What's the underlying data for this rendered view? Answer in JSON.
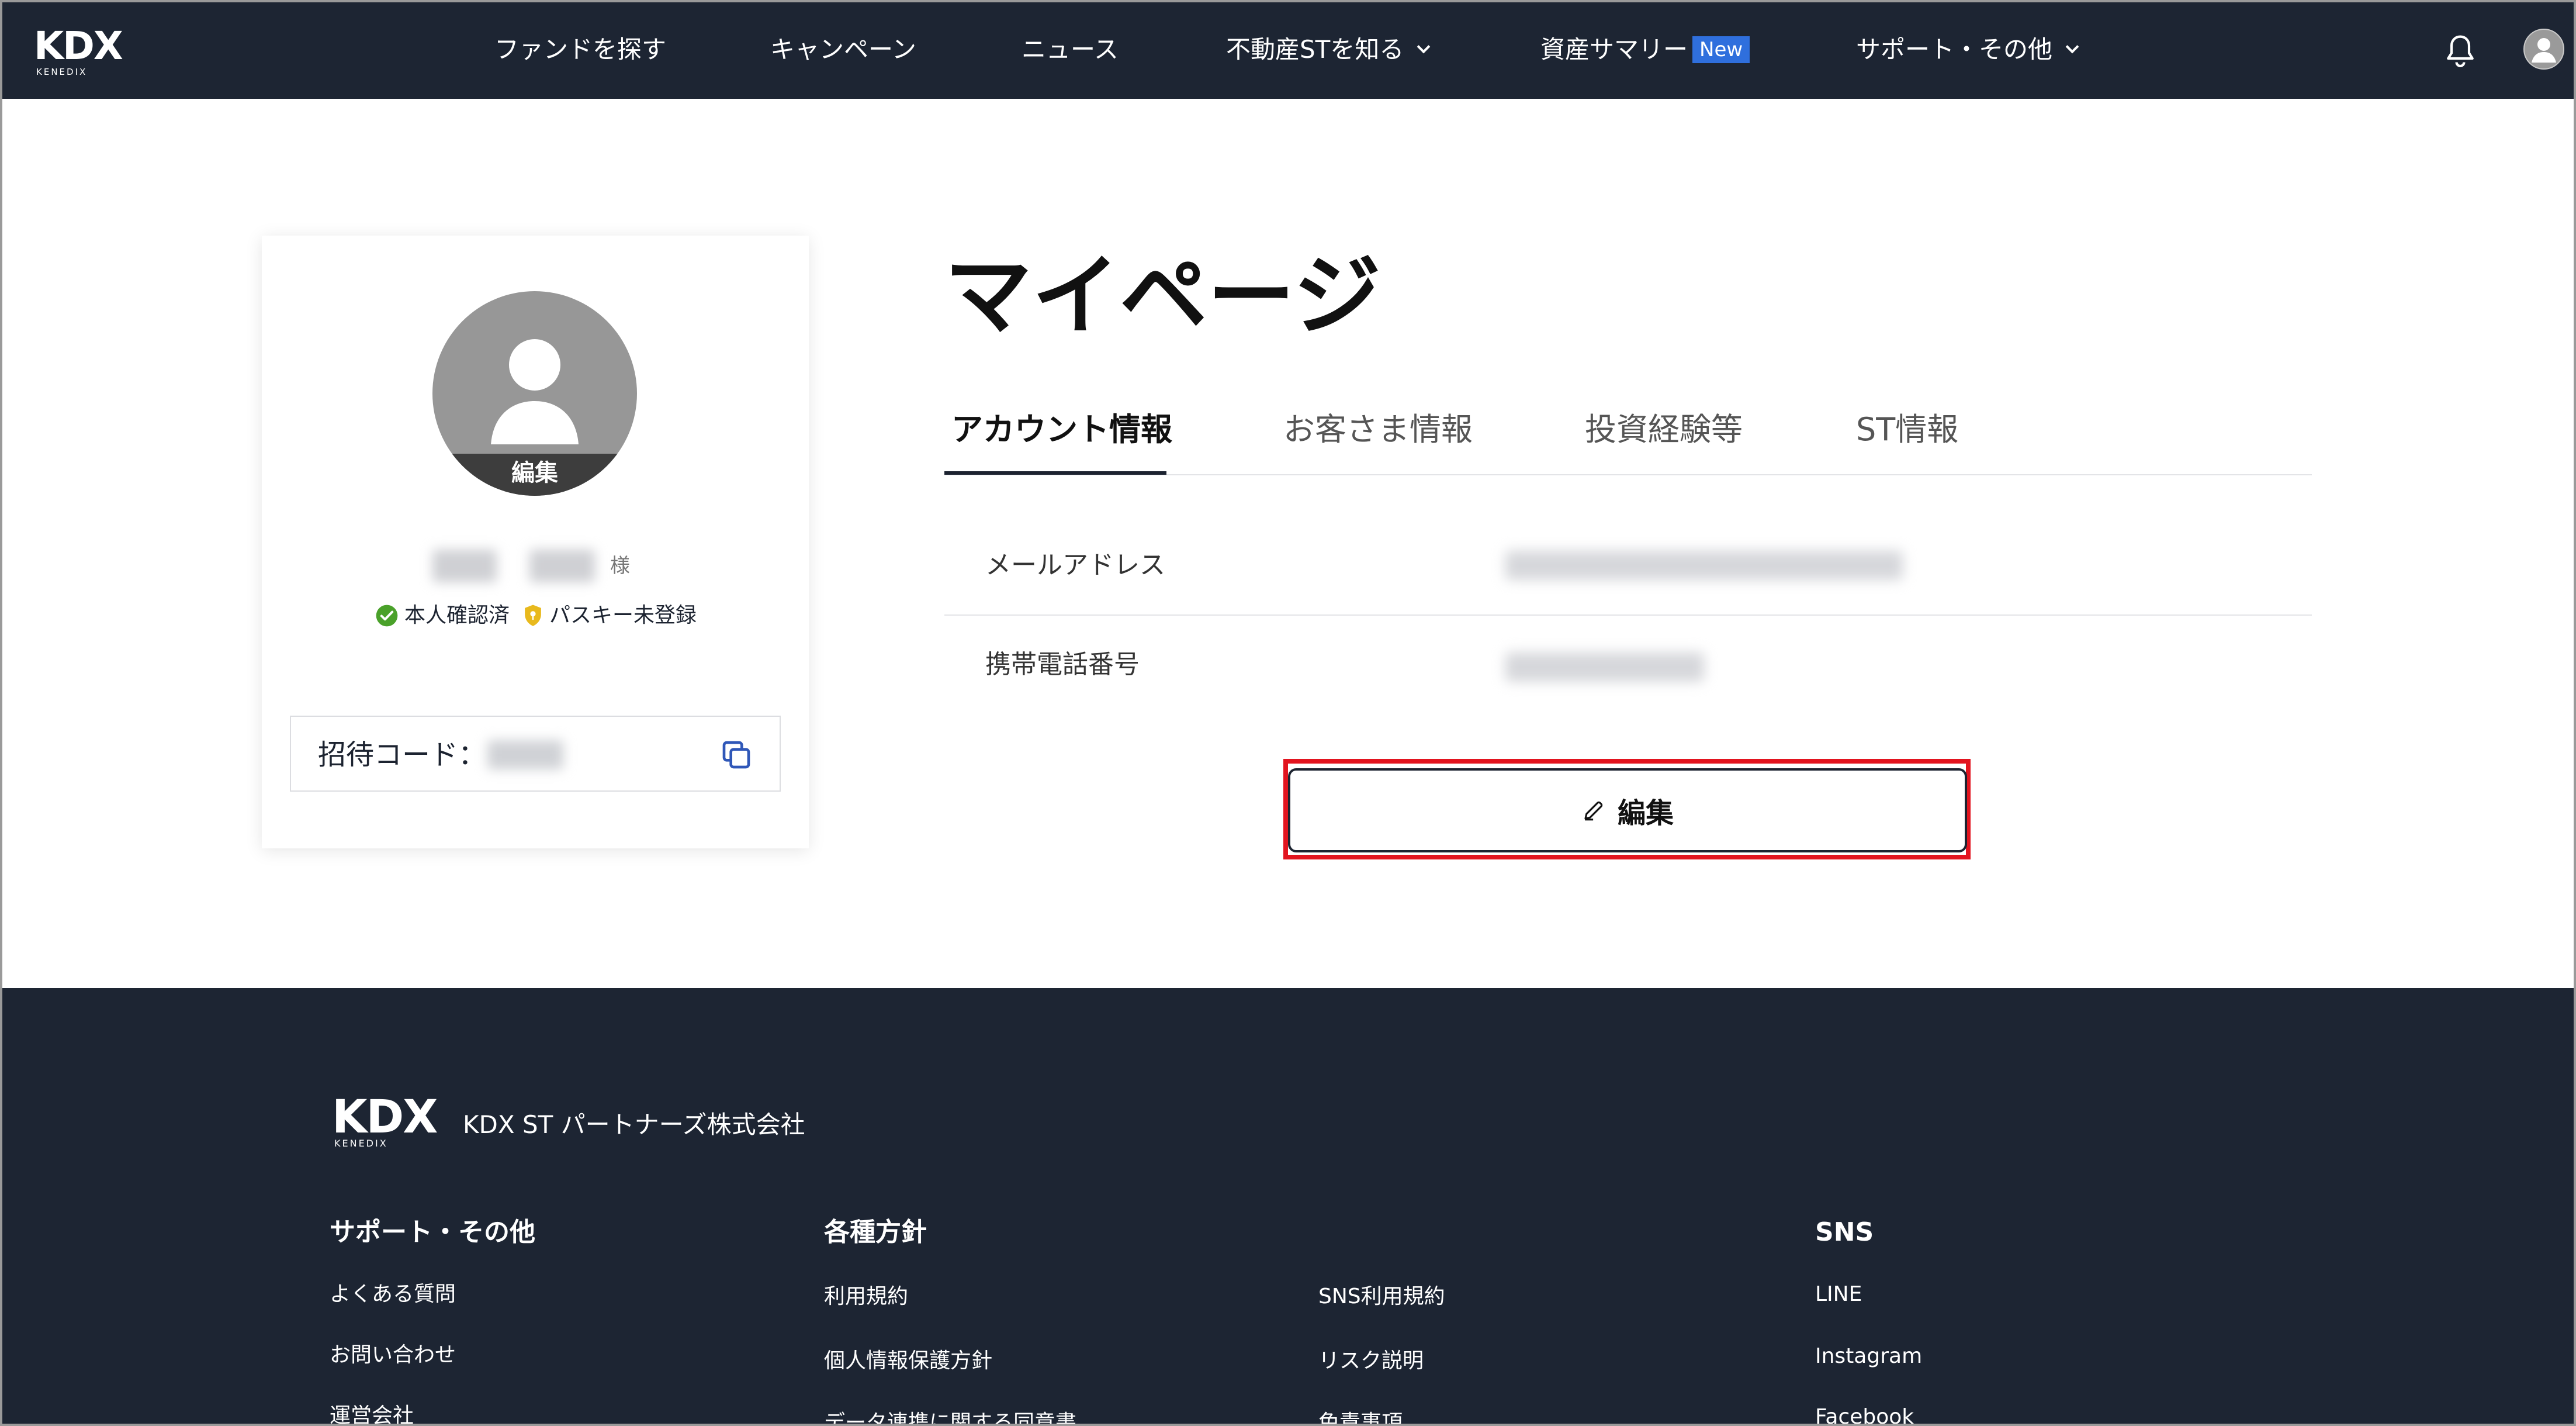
{
  "header": {
    "logo_text": "KDX",
    "logo_sub": "KENEDIX",
    "nav": [
      {
        "label": "ファンドを探す"
      },
      {
        "label": "キャンペーン"
      },
      {
        "label": "ニュース"
      },
      {
        "label": "不動産STを知る",
        "has_dropdown": true
      },
      {
        "label": "資産サマリー",
        "badge": "New"
      },
      {
        "label": "サポート・その他",
        "has_dropdown": true
      }
    ],
    "icons": {
      "notifications": "bell-icon",
      "account": "user-avatar-icon"
    }
  },
  "profile": {
    "avatar_edit_label": "編集",
    "honorific": "様",
    "status": [
      {
        "label": "本人確認済",
        "icon": "check-circle-icon",
        "color": "#4aa12a"
      },
      {
        "label": "パスキー未登録",
        "icon": "shield-icon",
        "color": "#e8b91d"
      }
    ],
    "invite_label": "招待コード：",
    "copy_icon": "copy-icon"
  },
  "main": {
    "title": "マイページ",
    "tabs": [
      {
        "label": "アカウント情報",
        "active": true
      },
      {
        "label": "お客さま情報",
        "active": false
      },
      {
        "label": "投資経験等",
        "active": false
      },
      {
        "label": "ST情報",
        "active": false
      }
    ],
    "rows": [
      {
        "label": "メールアドレス"
      },
      {
        "label": "携帯電話番号"
      }
    ],
    "edit_button": "編集"
  },
  "footer": {
    "logo_text": "KDX",
    "logo_sub": "KENEDIX",
    "company": "KDX ST パートナーズ株式会社",
    "columns": [
      {
        "heading": "サポート・その他",
        "links": [
          "よくある質問",
          "お問い合わせ",
          "運営会社"
        ]
      },
      {
        "heading": "各種方針",
        "links": [
          "利用規約",
          "個人情報保護方針",
          "データ連携に関する同意書"
        ]
      },
      {
        "heading": "",
        "links": [
          "SNS利用規約",
          "リスク説明",
          "免責事項"
        ]
      },
      {
        "heading": "SNS",
        "links": [
          "LINE",
          "Instagram",
          "Facebook"
        ]
      }
    ]
  },
  "colors": {
    "header_bg": "#1d2533",
    "footer_bg": "#1d2533",
    "new_badge": "#2f6fdd",
    "highlight": "#e2141f",
    "avatar_gray": "#979797"
  }
}
